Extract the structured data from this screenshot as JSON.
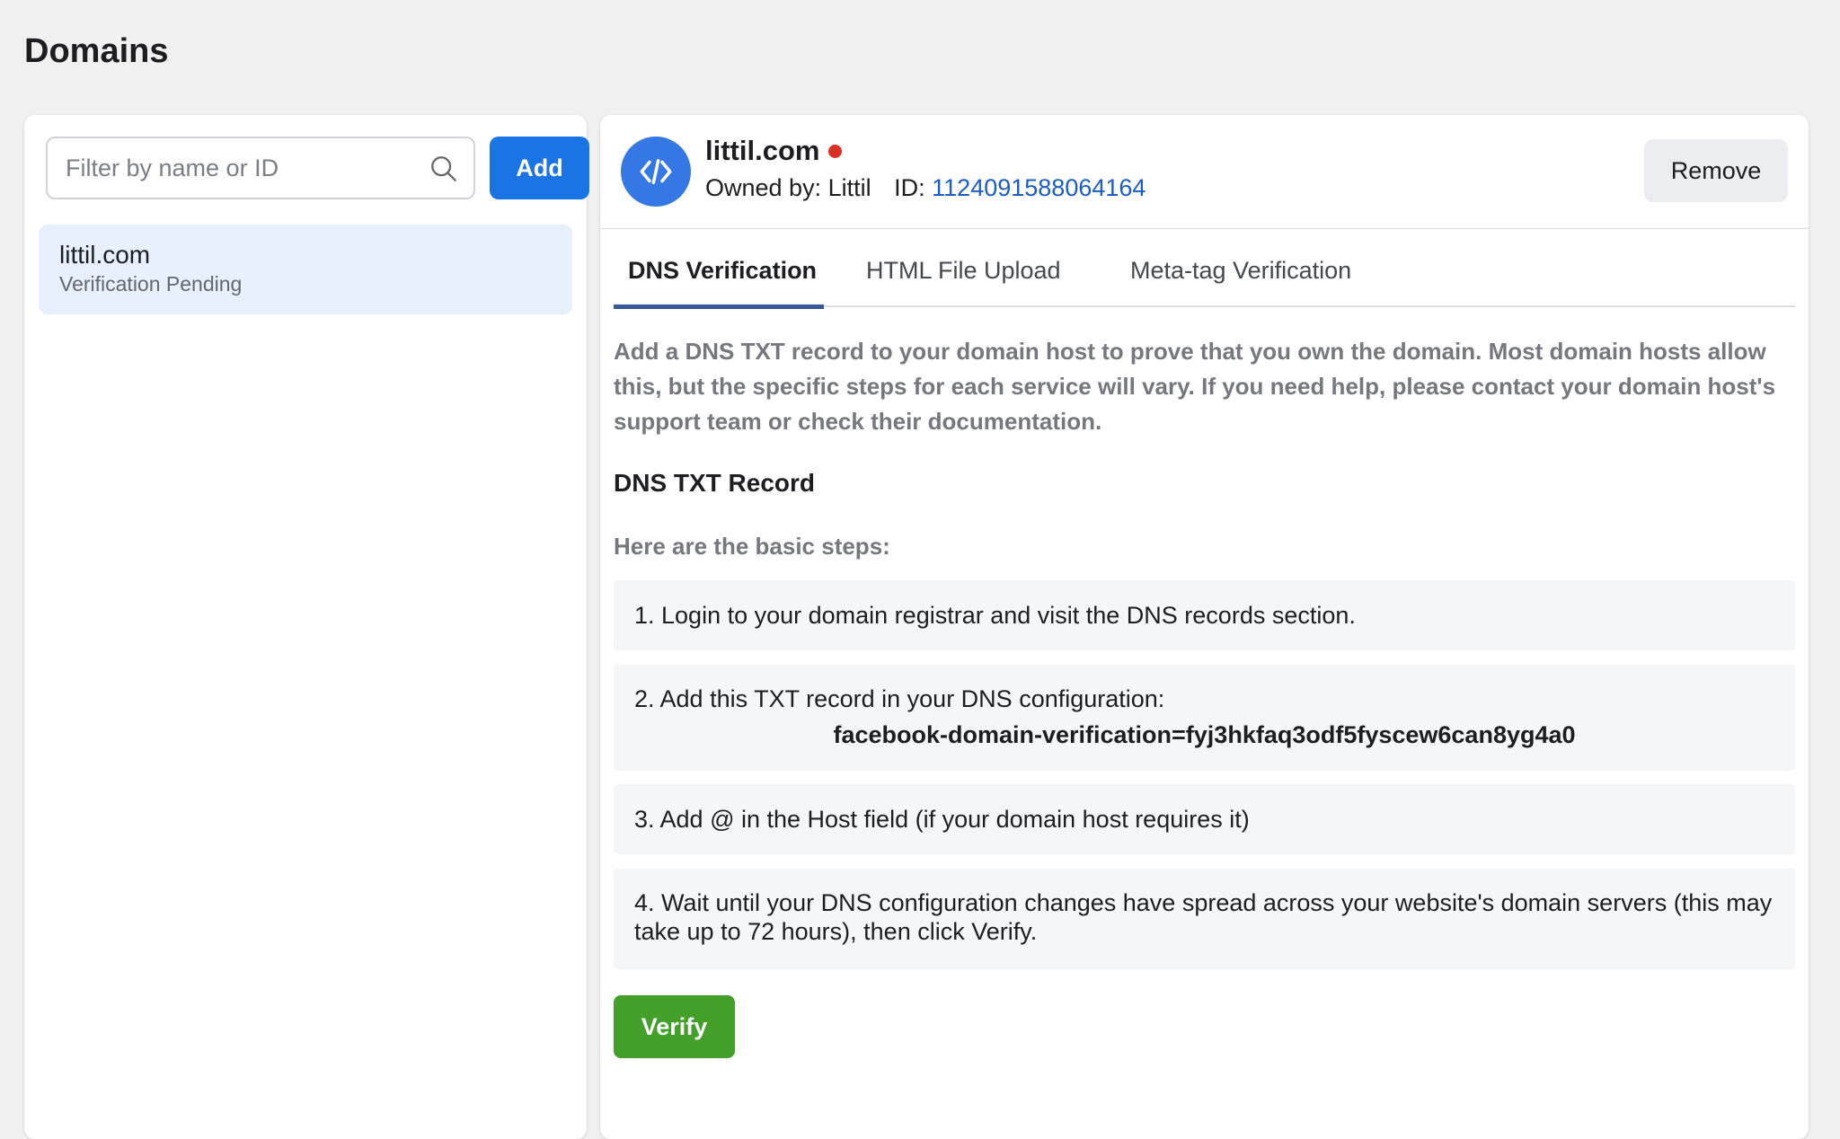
{
  "page": {
    "title": "Domains"
  },
  "sidebar": {
    "search": {
      "placeholder": "Filter by name or ID",
      "value": ""
    },
    "add_label": "Add",
    "domains": [
      {
        "name": "littil.com",
        "status": "Verification Pending"
      }
    ]
  },
  "detail": {
    "domain_name": "littil.com",
    "owner_label": "Owned by:",
    "owner_name": "Littil",
    "id_label": "ID:",
    "id_value": "1124091588064164",
    "remove_label": "Remove",
    "status_color": "#d93025",
    "tabs": [
      {
        "label": "DNS Verification",
        "active": true
      },
      {
        "label": "HTML File Upload",
        "active": false
      },
      {
        "label": "Meta-tag Verification",
        "active": false
      }
    ],
    "intro": "Add a DNS TXT record to your domain host to prove that you own the domain. Most domain hosts allow this, but the specific steps for each service will vary. If you need help, please contact your domain host's support team or check their documentation.",
    "section_title": "DNS TXT Record",
    "steps_label": "Here are the basic steps:",
    "steps": [
      "1. Login to your domain registrar and visit the DNS records section.",
      "2. Add this TXT record in your DNS configuration:",
      "3. Add @ in the Host field (if your domain host requires it)",
      "4. Wait until your DNS configuration changes have spread across your website's domain servers (this may take up to 72 hours), then click Verify."
    ],
    "txt_record": "facebook-domain-verification=fyj3hkfaq3odf5fyscew6can8yg4a0",
    "verify_label": "Verify"
  },
  "colors": {
    "primary_blue": "#1b74e4",
    "verify_green": "#42a028",
    "selected_bg": "#e7f0fd",
    "tab_underline": "#385898"
  },
  "icons": {
    "search": "search-icon",
    "domain_avatar": "code-icon"
  }
}
